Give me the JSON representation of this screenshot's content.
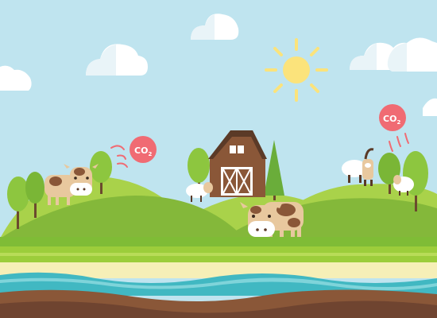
{
  "co2_badges": [
    {
      "label": "CO",
      "sub": "2"
    },
    {
      "label": "CO",
      "sub": "2"
    }
  ],
  "colors": {
    "sky": "#bfe4ef",
    "cloud": "#ffffff",
    "cloud_shade": "#e9f4f8",
    "sun": "#fbe37b",
    "sun_rays": "#fbe37b",
    "hill_light": "#a9d24a",
    "hill_dark": "#84b83a",
    "ground_green": "#7fbc36",
    "ground_band": "#9ccd3b",
    "sand": "#f6efb7",
    "water": "#41b8c2",
    "water_light": "#7fd4da",
    "soil": "#8a5738",
    "barn": "#8a5738",
    "barn_roof": "#5b3a27",
    "co2_badge": "#f06b73",
    "arrows": "#f06b73"
  }
}
